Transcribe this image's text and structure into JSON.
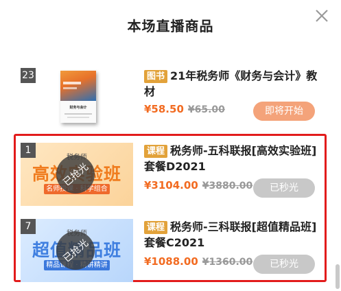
{
  "header": {
    "title": "本场直播商品"
  },
  "products": [
    {
      "index": "23",
      "tag": "图书",
      "name": "21年税务师《财务与会计》教材",
      "price": "¥58.50",
      "original_price": "¥65.00",
      "button": "即将开始",
      "thumb": {
        "book_title": "财务与会计"
      }
    },
    {
      "index": "1",
      "tag": "课程",
      "name": "税务师-五科联报[高效实验班]套餐D2021",
      "price": "¥3104.00",
      "original_price": "¥3880.00",
      "button": "已秒光",
      "thumb": {
        "top": "税务师",
        "main": "高效实验班",
        "strip": "名师授课 · 科学组合",
        "sold": "已抢光"
      }
    },
    {
      "index": "7",
      "tag": "课程",
      "name": "税务师-三科联报[超值精品班]套餐C2021",
      "price": "¥1088.00",
      "original_price": "¥1360.00",
      "button": "已秒光",
      "thumb": {
        "top": "税务师",
        "main": "超值精品班",
        "strip": "精品课程 · 精讲精讲",
        "sold": "已抢光"
      }
    }
  ],
  "colors": {
    "price": "#f26b21",
    "tag": "#e2a23a",
    "highlight": "#e21b1b",
    "button_soon": "#f4a37a",
    "button_sold": "#c8c8c8"
  }
}
